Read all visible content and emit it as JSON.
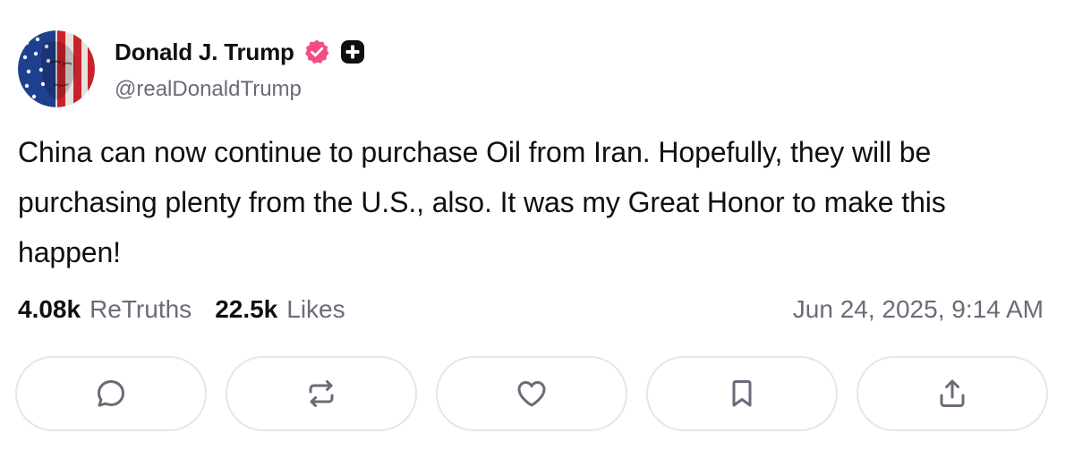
{
  "author": {
    "display_name": "Donald J. Trump",
    "handle": "@realDonaldTrump",
    "avatar_icon": "flag-portrait-avatar",
    "verified_icon": "verified-badge-icon",
    "verified_color": "#f04e83",
    "plus_badge_icon": "plus-badge-icon"
  },
  "post": {
    "text": "China can now continue to purchase Oil from Iran. Hopefully, they will be purchasing plenty from the U.S., also. It was my Great Honor to make this happen!"
  },
  "stats": {
    "retruths_count": "4.08k",
    "retruths_label": "ReTruths",
    "likes_count": "22.5k",
    "likes_label": "Likes",
    "timestamp": "Jun 24, 2025, 9:14 AM"
  },
  "actions": [
    {
      "icon": "reply-icon"
    },
    {
      "icon": "retruth-icon"
    },
    {
      "icon": "like-icon"
    },
    {
      "icon": "bookmark-icon"
    },
    {
      "icon": "share-icon"
    }
  ],
  "colors": {
    "text_primary": "#0f0f14",
    "text_secondary": "#6b6b78",
    "border": "#e6e6ea",
    "icon": "#6b6b78"
  }
}
